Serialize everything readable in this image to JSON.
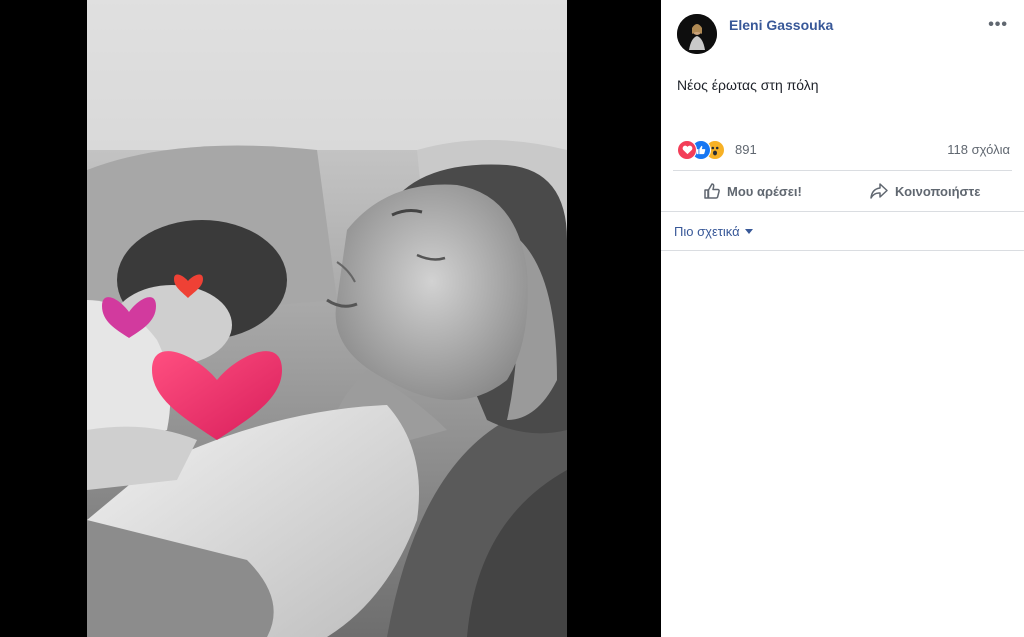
{
  "post": {
    "author": "Eleni Gassouka",
    "text": "Νέος έρωτας στη πόλη",
    "reactions_count": "891",
    "comments_count": "118 σχόλια",
    "reaction_icons": [
      "heart-reaction-icon",
      "like-reaction-icon",
      "wow-reaction-icon"
    ]
  },
  "actions": {
    "like_label": "Μου αρέσει!",
    "share_label": "Κοινοποιήστε"
  },
  "related": {
    "label": "Πιο σχετικά"
  },
  "colors": {
    "link_blue": "#385898",
    "love_red": "#f33e58",
    "like_blue": "#1877f2",
    "wow_yellow": "#f7b125",
    "sticker_pink": "#e8336f",
    "sticker_magenta": "#d23a9e",
    "sticker_red": "#ef4135"
  }
}
